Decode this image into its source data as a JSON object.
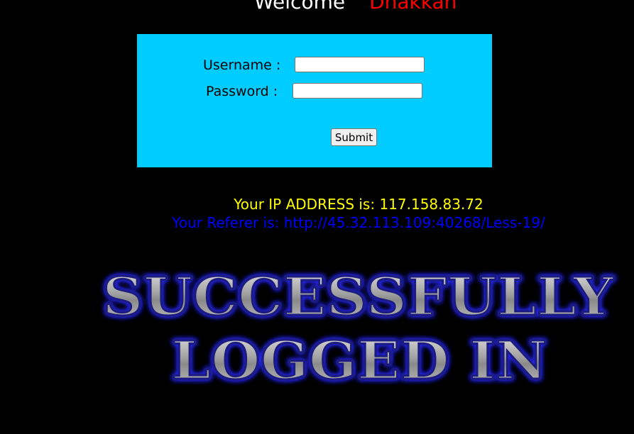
{
  "header": {
    "welcome_word": "Welcome",
    "user_name": "Dhakkan"
  },
  "login_form": {
    "username_label": "Username :",
    "username_value": "",
    "password_label": "Password :",
    "password_value": "",
    "submit_label": "Submit"
  },
  "info": {
    "ip_text": "Your IP ADDRESS is: 117.158.83.72",
    "referer_text": "Your Referer is: http://45.32.113.109:40268/Less-19/"
  },
  "banner": {
    "line1": "SUCCESSFULLY",
    "line2": "LOGGED IN"
  },
  "colors": {
    "background": "#000000",
    "form_bg": "#00ccff",
    "welcome": "#ffffff",
    "user_name": "#ff0000",
    "ip_text": "#ffff00",
    "referer_text": "#0000ff",
    "banner_glow": "#2020ff"
  }
}
